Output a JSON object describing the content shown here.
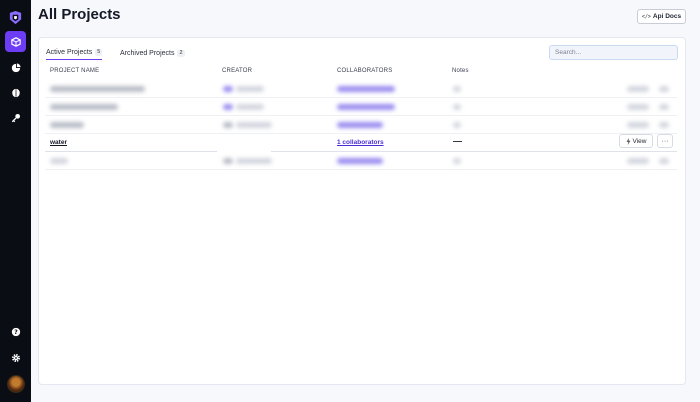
{
  "page": {
    "title": "All Projects"
  },
  "header": {
    "api_docs_label": "Api Docs",
    "api_docs_icon": "code-icon"
  },
  "sidebar": {
    "logo": "app-logo",
    "accent": "#6d3df5",
    "items": [
      {
        "icon": "projects-icon",
        "active": true
      },
      {
        "icon": "analytics-icon",
        "active": false
      },
      {
        "icon": "brain-icon",
        "active": false
      },
      {
        "icon": "key-icon",
        "active": false
      }
    ],
    "bottom_items": [
      {
        "icon": "help-icon"
      },
      {
        "icon": "settings-icon"
      }
    ]
  },
  "tabs": [
    {
      "label": "Active Projects",
      "count": "5",
      "active": true
    },
    {
      "label": "Archived Projects",
      "count": "2",
      "active": false
    }
  ],
  "search": {
    "placeholder": "Search..."
  },
  "table": {
    "columns": [
      "PROJECT NAME",
      "CREATOR",
      "COLLABORATORS",
      "Notes"
    ],
    "visible_row": {
      "name": "water",
      "collaborators": "1 collaborators",
      "notes": "—",
      "view_label": "View",
      "more_label": "···"
    }
  }
}
